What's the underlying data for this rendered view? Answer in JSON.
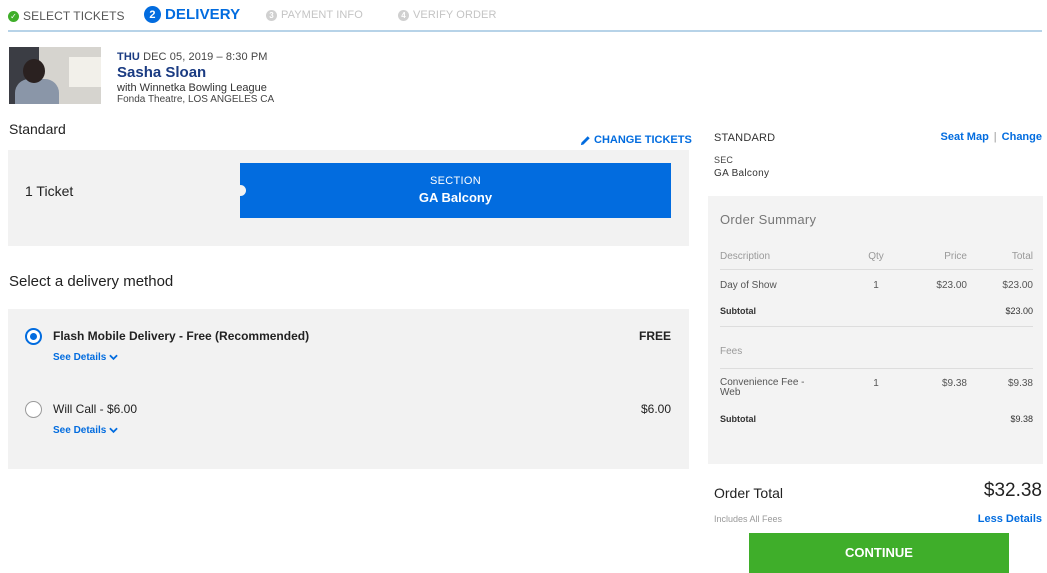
{
  "steps": [
    {
      "label": "SELECT TICKETS",
      "number": "✓",
      "state": "done"
    },
    {
      "label": "DELIVERY",
      "number": "2",
      "state": "active"
    },
    {
      "label": "PAYMENT INFO",
      "number": "3",
      "state": "todo"
    },
    {
      "label": "VERIFY ORDER",
      "number": "4",
      "state": "todo"
    }
  ],
  "event": {
    "day": "THU",
    "date_time": "DEC 05, 2019 – 8:30 PM",
    "artist": "Sasha Sloan",
    "support": "with Winnetka Bowling League",
    "venue": "Fonda Theatre, LOS ANGELES CA"
  },
  "tickets": {
    "type": "Standard",
    "change_label": "CHANGE TICKETS",
    "count": "1 Ticket",
    "section_label": "SECTION",
    "section_value": "GA Balcony"
  },
  "delivery": {
    "title": "Select a delivery method",
    "options": [
      {
        "label": "Flash Mobile Delivery - Free (Recommended)",
        "price": "FREE",
        "details": "See Details",
        "selected": true
      },
      {
        "label": "Will Call - $6.00",
        "price": "$6.00",
        "details": "See Details",
        "selected": false
      }
    ]
  },
  "sidebar": {
    "standard": "STANDARD",
    "seat_map": "Seat Map",
    "separator": "|",
    "change": "Change",
    "sec_label": "SEC",
    "sec_value": "GA Balcony"
  },
  "summary": {
    "title": "Order Summary",
    "headers": {
      "description": "Description",
      "qty": "Qty",
      "price": "Price",
      "total": "Total"
    },
    "tickets_row": {
      "description": "Day of Show",
      "qty": "1",
      "price": "$23.00",
      "total": "$23.00"
    },
    "tickets_subtotal": {
      "label": "Subtotal",
      "total": "$23.00"
    },
    "fees_label": "Fees",
    "fee_row": {
      "description": "Convenience Fee - Web",
      "qty": "1",
      "price": "$9.38",
      "total": "$9.38"
    },
    "fees_subtotal": {
      "label": "Subtotal",
      "total": "$9.38"
    }
  },
  "total": {
    "label": "Order Total",
    "value": "$32.38",
    "note": "Includes All Fees",
    "less_details": "Less Details",
    "continue": "CONTINUE"
  },
  "colors": {
    "brand_blue": "#026cdf",
    "navy": "#1a3b82",
    "success_green": "#3fae2a"
  }
}
